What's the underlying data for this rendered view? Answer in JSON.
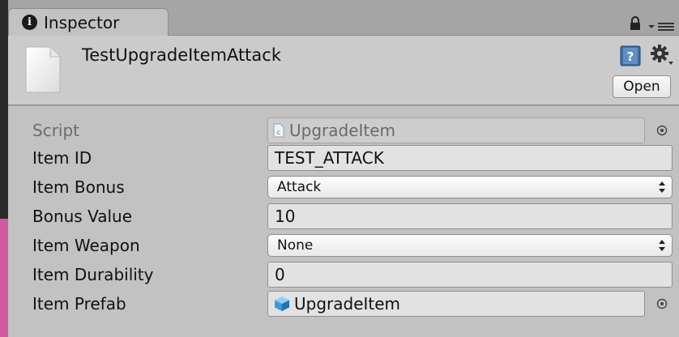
{
  "tab": {
    "title": "Inspector",
    "icon": "info-icon"
  },
  "header": {
    "asset_name": "TestUpgradeItemAttack",
    "open_label": "Open"
  },
  "properties": {
    "script": {
      "label": "Script",
      "value": "UpgradeItem"
    },
    "item_id": {
      "label": "Item ID",
      "value": "TEST_ATTACK"
    },
    "item_bonus": {
      "label": "Item Bonus",
      "value": "Attack"
    },
    "bonus_value": {
      "label": "Bonus Value",
      "value": "10"
    },
    "item_weapon": {
      "label": "Item Weapon",
      "value": "None"
    },
    "item_durability": {
      "label": "Item Durability",
      "value": "0"
    },
    "item_prefab": {
      "label": "Item Prefab",
      "value": "UpgradeItem"
    }
  },
  "colors": {
    "panel_bg": "#c2c2c2",
    "header_bg": "#cbcbcb",
    "field_bg": "#e2e2e2",
    "accent_pink": "#d35aa0"
  }
}
